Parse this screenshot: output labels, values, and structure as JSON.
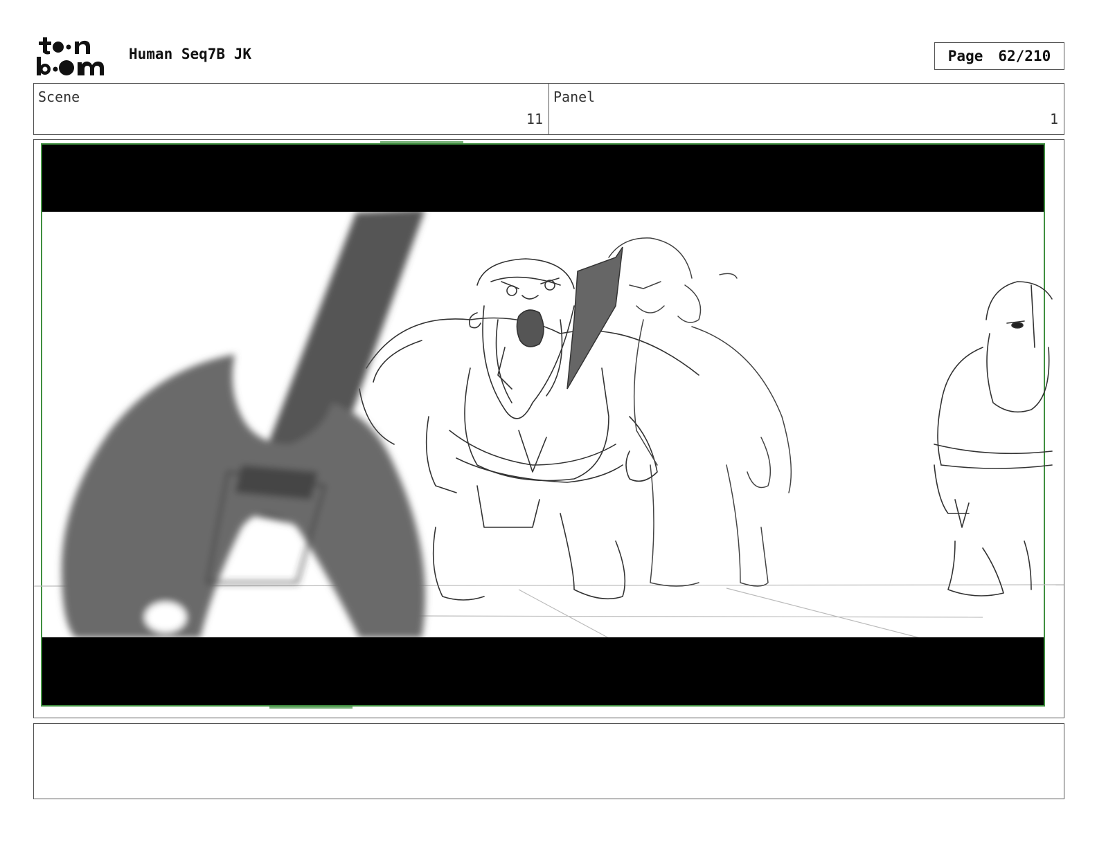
{
  "header": {
    "logo_line1": "toon",
    "logo_line2": "boom",
    "title": "Human Seq7B JK",
    "page_label": "Page",
    "page_value": "62/210"
  },
  "info": {
    "scene_label": "Scene",
    "scene_value": "11",
    "panel_label": "Panel",
    "panel_value": "1"
  },
  "notes": {
    "text": ""
  }
}
